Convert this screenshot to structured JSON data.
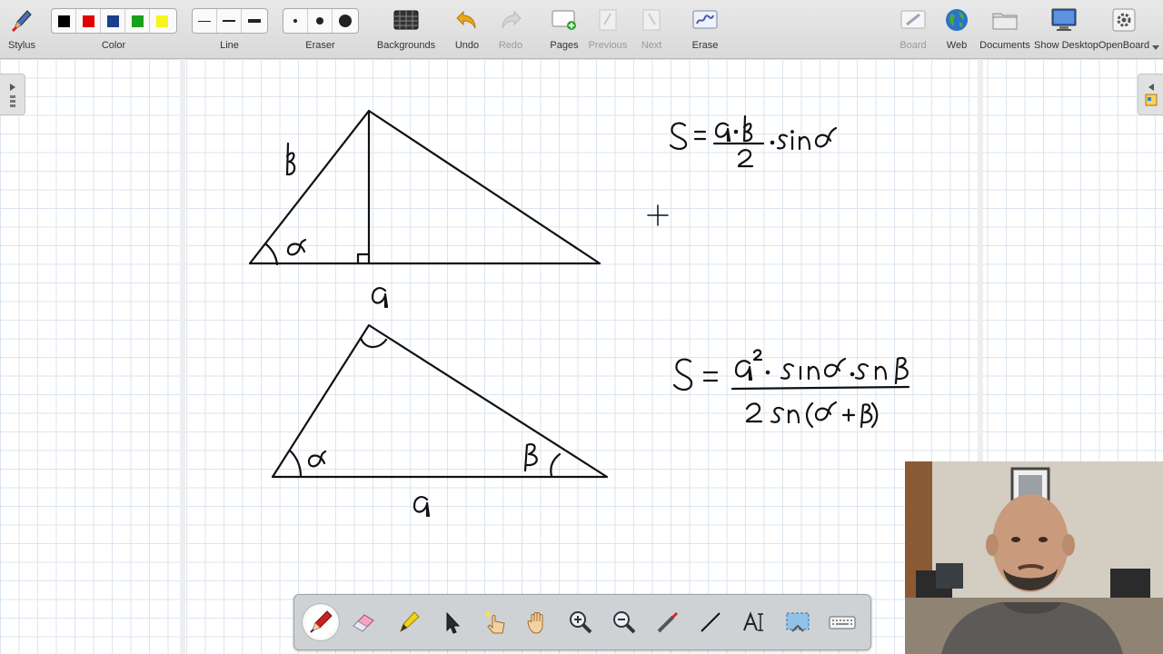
{
  "toolbar": {
    "stylus_label": "Stylus",
    "color_label": "Color",
    "line_label": "Line",
    "eraser_label": "Eraser",
    "backgrounds_label": "Backgrounds",
    "undo_label": "Undo",
    "redo_label": "Redo",
    "pages_label": "Pages",
    "previous_label": "Previous",
    "next_label": "Next",
    "erase_label": "Erase",
    "board_label": "Board",
    "web_label": "Web",
    "documents_label": "Documents",
    "show_desktop_label": "Show Desktop",
    "openboard_label": "OpenBoard",
    "colors": [
      "#000000",
      "#e00000",
      "#1a3f8f",
      "#1aa01a",
      "#f5f51a"
    ]
  },
  "board": {
    "triangle1": {
      "side_label": "a",
      "left_side_label": "b",
      "angle_label": "α"
    },
    "formula1": {
      "lhs": "S",
      "numerator": "a·b",
      "denominator": "2",
      "tail": "·sin α"
    },
    "triangle2": {
      "base_label": "a",
      "angle_left": "α",
      "angle_right": "β"
    },
    "formula2": {
      "lhs": "S",
      "numerator": "a²·sin α·sin β",
      "denominator": "2 sin(α+β)"
    }
  },
  "palette": {
    "tools": [
      "pen-tool",
      "eraser-tool",
      "marker-tool",
      "selector-tool",
      "laser-pointer-tool",
      "hand-tool",
      "zoom-in-tool",
      "zoom-out-tool",
      "pointer-tool",
      "line-tool",
      "text-tool",
      "capture-tool",
      "keyboard-tool"
    ]
  }
}
